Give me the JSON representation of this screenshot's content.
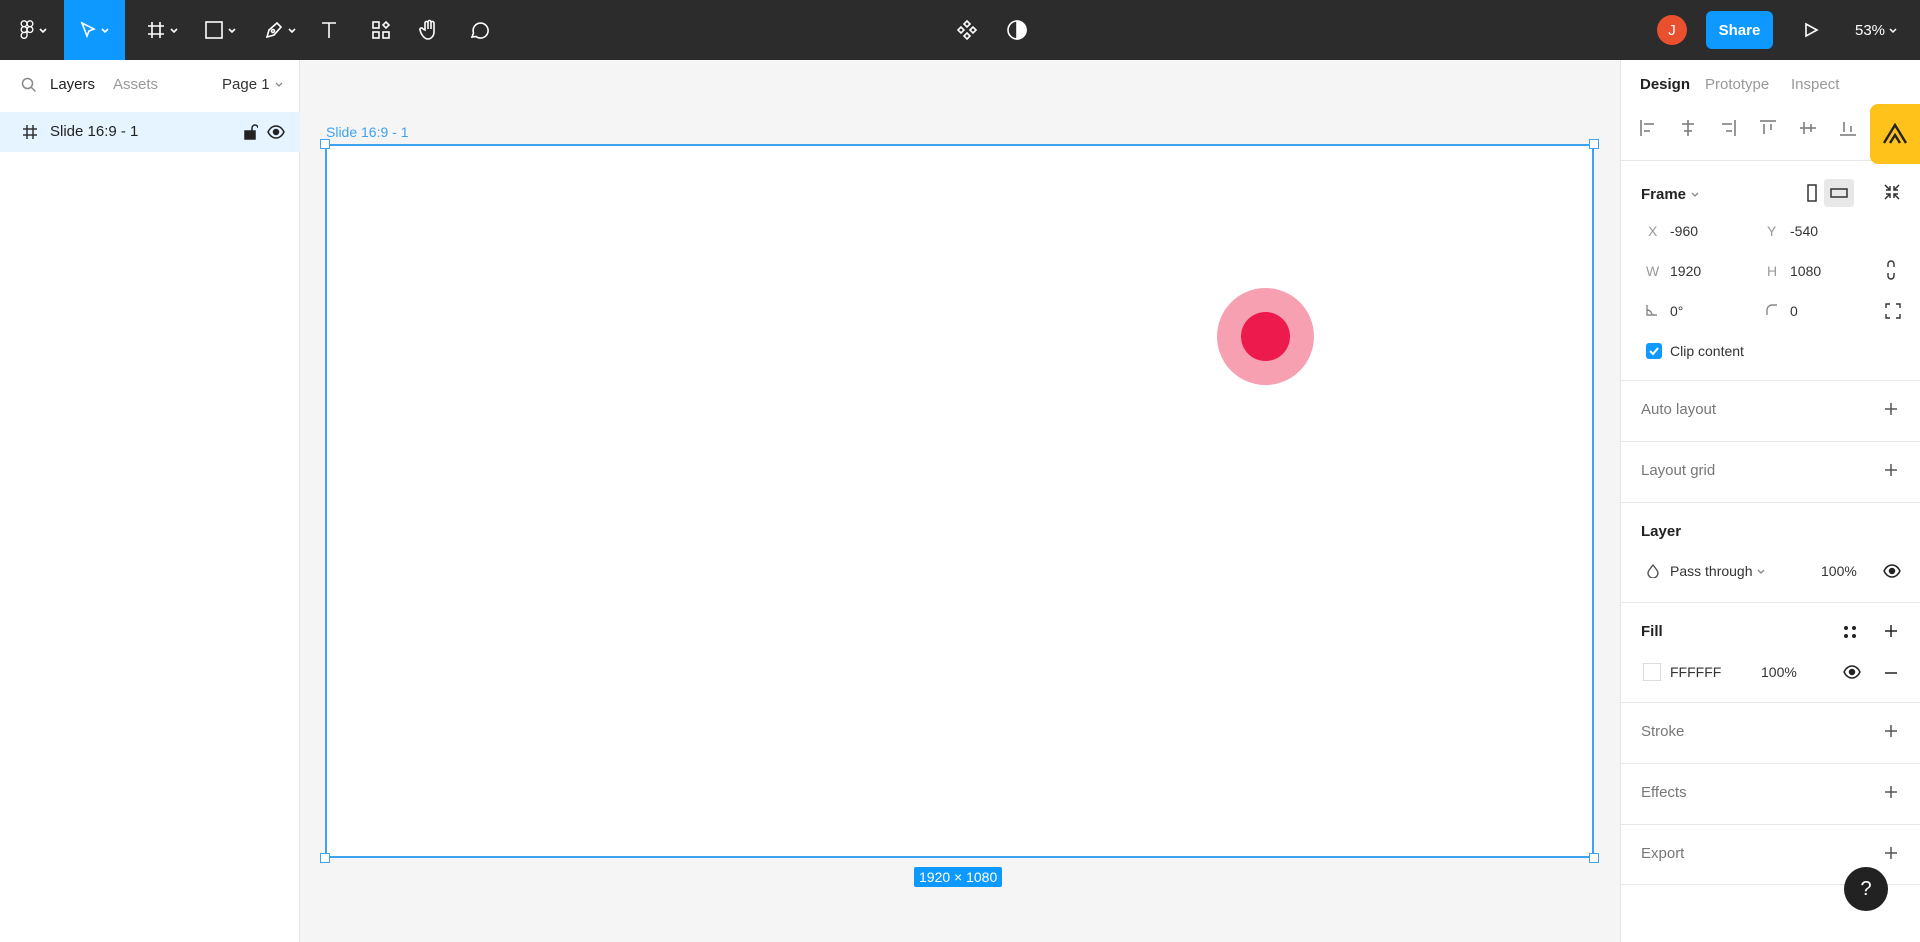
{
  "toolbar": {
    "avatar_initial": "J",
    "share_label": "Share",
    "zoom": "53%"
  },
  "left_panel": {
    "tabs": [
      "Layers",
      "Assets"
    ],
    "page": "Page 1",
    "layers": [
      {
        "name": "Slide 16:9 - 1"
      }
    ]
  },
  "canvas": {
    "frame_label": "Slide 16:9 - 1",
    "size_badge": "1920 × 1080",
    "colors": {
      "outer_circle": "#f6a0b2",
      "inner_circle": "#ec1a4d",
      "selection": "#3da2f0"
    }
  },
  "right_panel": {
    "tabs": [
      "Design",
      "Prototype",
      "Inspect"
    ],
    "frame": {
      "title": "Frame",
      "x_label": "X",
      "x": "-960",
      "y_label": "Y",
      "y": "-540",
      "w_label": "W",
      "w": "1920",
      "h_label": "H",
      "h": "1080",
      "rotation": "0°",
      "radius": "0",
      "clip_content": "Clip content"
    },
    "auto_layout": "Auto layout",
    "layout_grid": "Layout grid",
    "layer": {
      "title": "Layer",
      "blend": "Pass through",
      "opacity": "100%"
    },
    "fill": {
      "title": "Fill",
      "hex": "FFFFFF",
      "opacity": "100%"
    },
    "stroke": "Stroke",
    "effects": "Effects",
    "export": "Export"
  },
  "help_label": "?"
}
